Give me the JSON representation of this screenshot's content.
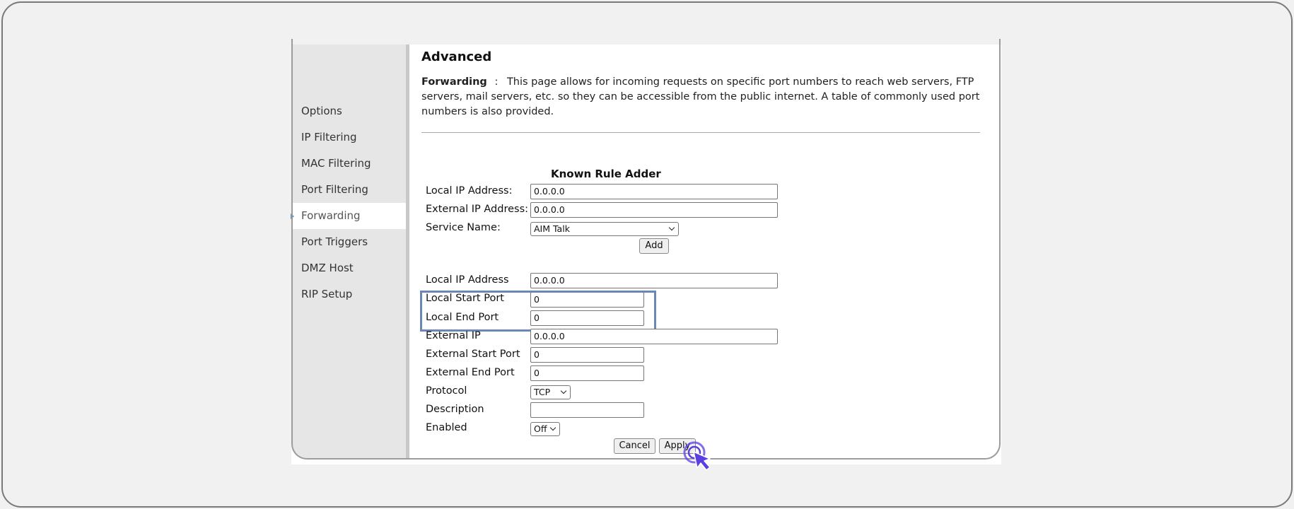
{
  "sidebar": {
    "items": [
      {
        "label": "Options",
        "active": false
      },
      {
        "label": "IP Filtering",
        "active": false
      },
      {
        "label": "MAC Filtering",
        "active": false
      },
      {
        "label": "Port Filtering",
        "active": false
      },
      {
        "label": "Forwarding",
        "active": true
      },
      {
        "label": "Port Triggers",
        "active": false
      },
      {
        "label": "DMZ Host",
        "active": false
      },
      {
        "label": "RIP Setup",
        "active": false
      }
    ]
  },
  "main": {
    "title": "Advanced",
    "intro_term": "Forwarding",
    "intro_sep": ":",
    "intro_text": "This page allows for incoming requests on specific port numbers to reach web servers, FTP servers, mail servers, etc. so they can be accessible from the public internet. A table of commonly used port numbers is also provided."
  },
  "known_rule_adder": {
    "heading": "Known Rule Adder",
    "local_ip_label": "Local IP Address:",
    "local_ip_value": "0.0.0.0",
    "external_ip_label": "External IP Address:",
    "external_ip_value": "0.0.0.0",
    "service_name_label": "Service Name:",
    "service_name_value": "AIM Talk",
    "add_label": "Add"
  },
  "rule_form": {
    "local_ip_label": "Local IP Address",
    "local_ip_value": "0.0.0.0",
    "local_start_port_label": "Local Start Port",
    "local_start_port_value": "0",
    "local_end_port_label": "Local End Port",
    "local_end_port_value": "0",
    "external_ip_label": "External IP",
    "external_ip_value": "0.0.0.0",
    "external_start_port_label": "External Start Port",
    "external_start_port_value": "0",
    "external_end_port_label": "External End Port",
    "external_end_port_value": "0",
    "protocol_label": "Protocol",
    "protocol_value": "TCP",
    "description_label": "Description",
    "description_value": "",
    "enabled_label": "Enabled",
    "enabled_value": "Off",
    "cancel_label": "Cancel",
    "apply_label": "Apply"
  },
  "colors": {
    "highlight": "#6b87b3",
    "cursor": "#5b3fe0",
    "active_marker": "#4a90c2"
  }
}
